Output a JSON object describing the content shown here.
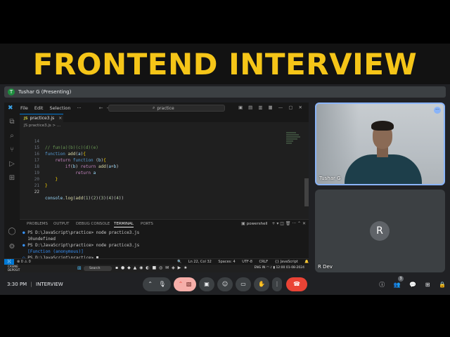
{
  "banner": {
    "title": "FRONTEND INTERVIEW"
  },
  "presenter": {
    "avatar_letter": "T",
    "name": "Tushar G (Presenting)"
  },
  "vscode": {
    "menu": [
      "File",
      "Edit",
      "Selection",
      "···"
    ],
    "search_placeholder": "practice",
    "tab": {
      "badge": "JS",
      "filename": "practice3.js",
      "close": "×"
    },
    "breadcrumb": "JS practice3.js > ...",
    "code_lines": [
      {
        "num": "14",
        "text": "// fun(a)(b)(c)(d)(e)"
      },
      {
        "num": "15",
        "text": "function add(a){"
      },
      {
        "num": "16",
        "text": "    return function (b){"
      },
      {
        "num": "17",
        "text": "        if(b) return add(a+b)"
      },
      {
        "num": "18",
        "text": "            return a"
      },
      {
        "num": "19",
        "text": "    }"
      },
      {
        "num": "20",
        "text": "}"
      },
      {
        "num": "21",
        "text": ""
      },
      {
        "num": "22",
        "text": "console.log(add(1)(2)(3)(4)(4))"
      }
    ],
    "panel_tabs": [
      "PROBLEMS",
      "OUTPUT",
      "DEBUG CONSOLE",
      "TERMINAL",
      "PORTS"
    ],
    "active_panel_tab": "TERMINAL",
    "terminal_shell": "powershell",
    "terminal_lines": [
      "PS D:\\JavaScript\\practice> node practice3.js",
      "10undefined",
      "PS D:\\JavaScript\\practice> node practice3.js",
      "[Function (anonymous)]",
      "PS D:\\JavaScript\\practice> "
    ],
    "status": {
      "errors": "⊗ 0  ⚠ 0",
      "position": "Ln 22, Col 32",
      "spaces": "Spaces: 4",
      "encoding": "UTF-8",
      "eol": "CRLF",
      "language": "{} JavaScript"
    },
    "taskbar": {
      "weather_line1": "CASINE",
      "weather_line2": "DEPOSIT",
      "search": "Search",
      "tray": "ENG IN",
      "time": "12:00",
      "date": "01-08-2024"
    }
  },
  "participants": [
    {
      "name": "Tushar G",
      "more": "···"
    },
    {
      "name": "R Dev",
      "avatar_letter": "R"
    }
  ],
  "meet_bar": {
    "time": "3:30 PM",
    "separator": "|",
    "meeting_name": "INTERVIEW",
    "participant_count": "3"
  },
  "icons": {
    "mic": "mic-icon",
    "camera_off": "camera-off-icon",
    "present": "present-icon",
    "emoji": "emoji-icon",
    "captions": "captions-icon",
    "hand": "raise-hand-icon",
    "more": "more-vert-icon",
    "end_call": "end-call-icon"
  },
  "colors": {
    "banner_text": "#f5c518",
    "end_call": "#ea4335",
    "active_speaker_border": "#8ab4f8",
    "vscode_accent": "#0078d4"
  }
}
